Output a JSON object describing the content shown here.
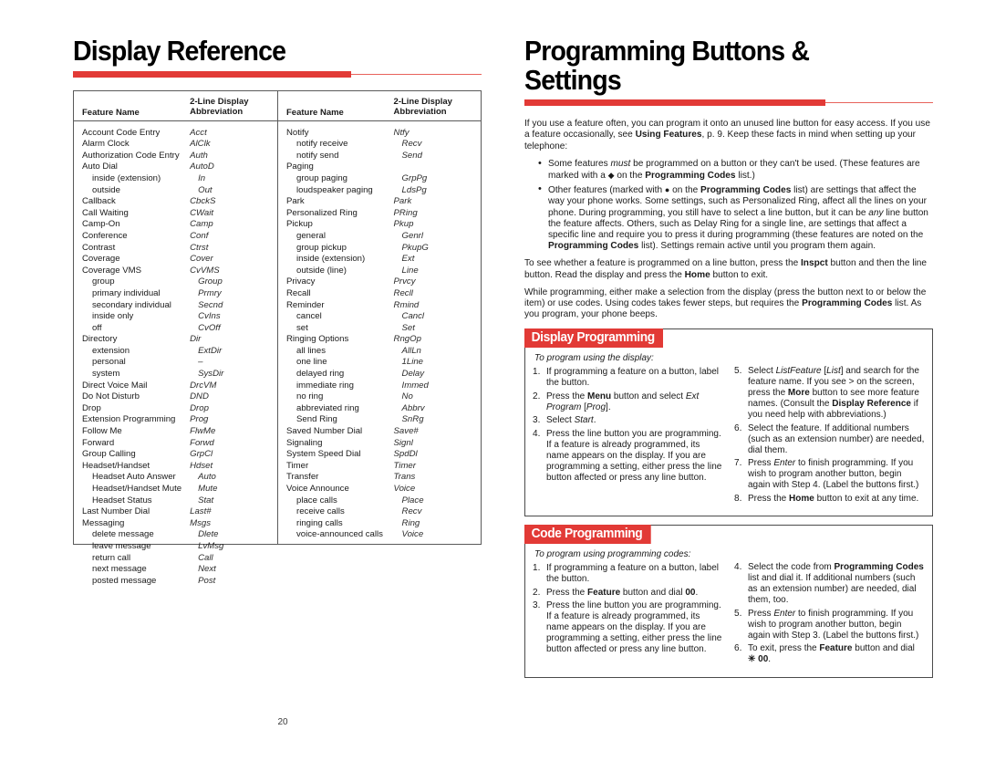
{
  "left_page": {
    "title": "Display Reference",
    "table": {
      "headers": {
        "feature_name": "Feature Name",
        "abbreviation_line1": "2-Line Display",
        "abbreviation_line2": "Abbreviation"
      },
      "column_1": [
        {
          "name": "Account Code Entry",
          "abbr": "Acct",
          "sub": false
        },
        {
          "name": "Alarm Clock",
          "abbr": "AlClk",
          "sub": false
        },
        {
          "name": "Authorization Code Entry",
          "abbr": "Auth",
          "sub": false
        },
        {
          "name": "Auto Dial",
          "abbr": "AutoD",
          "sub": false
        },
        {
          "name": "inside (extension)",
          "abbr": "In",
          "sub": true
        },
        {
          "name": "outside",
          "abbr": "Out",
          "sub": true
        },
        {
          "name": "Callback",
          "abbr": "CbckS",
          "sub": false
        },
        {
          "name": "Call Waiting",
          "abbr": "CWait",
          "sub": false
        },
        {
          "name": "Camp-On",
          "abbr": "Camp",
          "sub": false
        },
        {
          "name": "Conference",
          "abbr": "Conf",
          "sub": false
        },
        {
          "name": "Contrast",
          "abbr": "Ctrst",
          "sub": false
        },
        {
          "name": "Coverage",
          "abbr": "Cover",
          "sub": false
        },
        {
          "name": "Coverage VMS",
          "abbr": "CvVMS",
          "sub": false
        },
        {
          "name": "group",
          "abbr": "Group",
          "sub": true
        },
        {
          "name": "primary individual",
          "abbr": "Prmry",
          "sub": true
        },
        {
          "name": "secondary individual",
          "abbr": "Secnd",
          "sub": true
        },
        {
          "name": "inside only",
          "abbr": "CvIns",
          "sub": true
        },
        {
          "name": "off",
          "abbr": "CvOff",
          "sub": true
        },
        {
          "name": "Directory",
          "abbr": "Dir",
          "sub": false
        },
        {
          "name": "extension",
          "abbr": "ExtDir",
          "sub": true
        },
        {
          "name": "personal",
          "abbr": "–",
          "sub": true
        },
        {
          "name": "system",
          "abbr": "SysDir",
          "sub": true
        },
        {
          "name": "Direct Voice Mail",
          "abbr": "DrcVM",
          "sub": false
        },
        {
          "name": "Do Not Disturb",
          "abbr": "DND",
          "sub": false
        },
        {
          "name": "Drop",
          "abbr": "Drop",
          "sub": false
        },
        {
          "name": "Extension Programming",
          "abbr": "Prog",
          "sub": false
        },
        {
          "name": "Follow Me",
          "abbr": "FlwMe",
          "sub": false
        },
        {
          "name": "Forward",
          "abbr": "Forwd",
          "sub": false
        },
        {
          "name": "Group Calling",
          "abbr": "GrpCl",
          "sub": false
        },
        {
          "name": "Headset/Handset",
          "abbr": "Hdset",
          "sub": false
        },
        {
          "name": "Headset Auto Answer",
          "abbr": "Auto",
          "sub": true
        },
        {
          "name": "Headset/Handset Mute",
          "abbr": "Mute",
          "sub": true
        },
        {
          "name": "Headset Status",
          "abbr": "Stat",
          "sub": true
        },
        {
          "name": "Last Number Dial",
          "abbr": "Last#",
          "sub": false
        },
        {
          "name": "Messaging",
          "abbr": "Msgs",
          "sub": false
        },
        {
          "name": "delete message",
          "abbr": "Dlete",
          "sub": true
        },
        {
          "name": "leave message",
          "abbr": "LvMsg",
          "sub": true
        },
        {
          "name": "return call",
          "abbr": "Call",
          "sub": true
        },
        {
          "name": "next message",
          "abbr": "Next",
          "sub": true
        },
        {
          "name": "posted message",
          "abbr": "Post",
          "sub": true
        }
      ],
      "column_2": [
        {
          "name": "Notify",
          "abbr": "Ntfy",
          "sub": false
        },
        {
          "name": "notify receive",
          "abbr": "Recv",
          "sub": true
        },
        {
          "name": "notify send",
          "abbr": "Send",
          "sub": true
        },
        {
          "name": "Paging",
          "abbr": "",
          "sub": false
        },
        {
          "name": "group paging",
          "abbr": "GrpPg",
          "sub": true
        },
        {
          "name": "loudspeaker paging",
          "abbr": "LdsPg",
          "sub": true
        },
        {
          "name": "Park",
          "abbr": "Park",
          "sub": false
        },
        {
          "name": "Personalized Ring",
          "abbr": "PRing",
          "sub": false
        },
        {
          "name": "Pickup",
          "abbr": "Pkup",
          "sub": false
        },
        {
          "name": "general",
          "abbr": "Genrl",
          "sub": true
        },
        {
          "name": "group pickup",
          "abbr": "PkupG",
          "sub": true
        },
        {
          "name": "inside (extension)",
          "abbr": "Ext",
          "sub": true
        },
        {
          "name": "outside (line)",
          "abbr": "Line",
          "sub": true
        },
        {
          "name": "Privacy",
          "abbr": "Prvcy",
          "sub": false
        },
        {
          "name": "Recall",
          "abbr": "Recll",
          "sub": false
        },
        {
          "name": "Reminder",
          "abbr": "Rmind",
          "sub": false
        },
        {
          "name": "cancel",
          "abbr": "Cancl",
          "sub": true
        },
        {
          "name": "set",
          "abbr": "Set",
          "sub": true
        },
        {
          "name": "Ringing Options",
          "abbr": "RngOp",
          "sub": false
        },
        {
          "name": "all lines",
          "abbr": "AllLn",
          "sub": true
        },
        {
          "name": "one line",
          "abbr": "1Line",
          "sub": true
        },
        {
          "name": "delayed ring",
          "abbr": "Delay",
          "sub": true
        },
        {
          "name": "immediate ring",
          "abbr": "Immed",
          "sub": true
        },
        {
          "name": "no ring",
          "abbr": "No",
          "sub": true
        },
        {
          "name": "abbreviated ring",
          "abbr": "Abbrv",
          "sub": true
        },
        {
          "name": "Send Ring",
          "abbr": "SnRg",
          "sub": true
        },
        {
          "name": "Saved Number Dial",
          "abbr": "Save#",
          "sub": false
        },
        {
          "name": "Signaling",
          "abbr": "Signl",
          "sub": false
        },
        {
          "name": "System Speed Dial",
          "abbr": "SpdDl",
          "sub": false
        },
        {
          "name": "Timer",
          "abbr": "Timer",
          "sub": false
        },
        {
          "name": "Transfer",
          "abbr": "Trans",
          "sub": false
        },
        {
          "name": "Voice Announce",
          "abbr": "Voice",
          "sub": false
        },
        {
          "name": "place calls",
          "abbr": "Place",
          "sub": true
        },
        {
          "name": "receive calls",
          "abbr": "Recv",
          "sub": true
        },
        {
          "name": "ringing calls",
          "abbr": "Ring",
          "sub": true
        },
        {
          "name": "voice-announced calls",
          "abbr": "Voice",
          "sub": true
        }
      ]
    }
  },
  "right_page": {
    "title": "Programming Buttons & Settings",
    "intro_paragraph_html": "If you use a feature often, you can program it onto an unused line button for easy access. If you use a feature occasionally, see <b>Using Features</b>, p. 9. Keep these facts in mind when setting up your telephone:",
    "bullets_html": [
      "Some features <i>must</i> be programmed on a button or they can't be used. (These features are marked with a <span class=\"dia\">◆</span> on the <b>Programming Codes</b> list.)",
      "Other features (marked with <span class=\"dia\">●</span> on the <b>Programming Codes</b> list) are settings that affect the way your phone works. Some settings, such as Personalized Ring, affect all the lines on your phone. During programming, you still have to select a line button, but it can be <i>any</i> line button the feature affects. Others, such as Delay Ring for a single line, are settings that affect a specific line and require you to press it during programming (these features are noted on the <b>Programming Codes</b> list). Settings remain active until you program them again."
    ],
    "paragraph_2_html": "To see whether a feature is programmed on a line button, press the <b>Inspct</b> button and then the line button. Read the display and press the <b>Home</b> button to exit.",
    "paragraph_3_html": "While programming, either make a selection from the display (press the button next to or below the item) or use codes. Using codes takes fewer steps, but requires the <b>Programming Codes</b> list. As you program, your phone beeps.",
    "display_programming": {
      "tab_label": "Display Programming",
      "lead_in": "To program using the display:",
      "steps_left_html": [
        "If programming a feature on a button, label the button.",
        "Press the <b>Menu</b> button and select <i>Ext Program</i> [<i>Prog</i>].",
        "Select <i>Start</i>.",
        "Press the line button you are programming. If a feature is already programmed, its name appears on the display. If you are programming a setting, either press the line button affected or press any line button."
      ],
      "steps_right_html": [
        "Select <i>ListFeature</i> [<i>List</i>] and search for the feature name. If you see &gt; on the screen, press the <b>More</b> button to see more feature names. (Consult the <b>Display Reference</b> if you need help with abbreviations.)",
        "Select the feature. If additional numbers (such as an extension number) are needed, dial them.",
        "Press <i>Enter</i> to finish programming. If you wish to program another button, begin again with Step 4. (Label the buttons first.)",
        "Press the <b>Home</b> button to exit at any time."
      ]
    },
    "code_programming": {
      "tab_label": "Code Programming",
      "lead_in": "To program using programming codes:",
      "steps_left_html": [
        "If programming a feature on a button, label the button.",
        "Press the <b>Feature</b> button and dial <b>00</b>.",
        "Press the line button you are programming. If a feature is already programmed, its name appears on the display. If you are programming a setting, either press the line button affected or press any line button."
      ],
      "steps_right_html": [
        "Select the code from <b>Programming Codes</b> list and dial it. If additional numbers (such as an extension number) are needed, dial them, too.",
        "Press <i>Enter</i> to finish programming. If you wish to program another button, begin again with Step 3. (Label the buttons first.)",
        "To exit, press the <b>Feature</b> button and dial <b>✳ 00</b>."
      ]
    }
  },
  "footer": {
    "page_number": "20"
  },
  "colors": {
    "accent_red": "#e23a36",
    "rule_light_red": "#e8625c",
    "table_border": "#5a5a5a",
    "text": "#1a1a1a"
  }
}
